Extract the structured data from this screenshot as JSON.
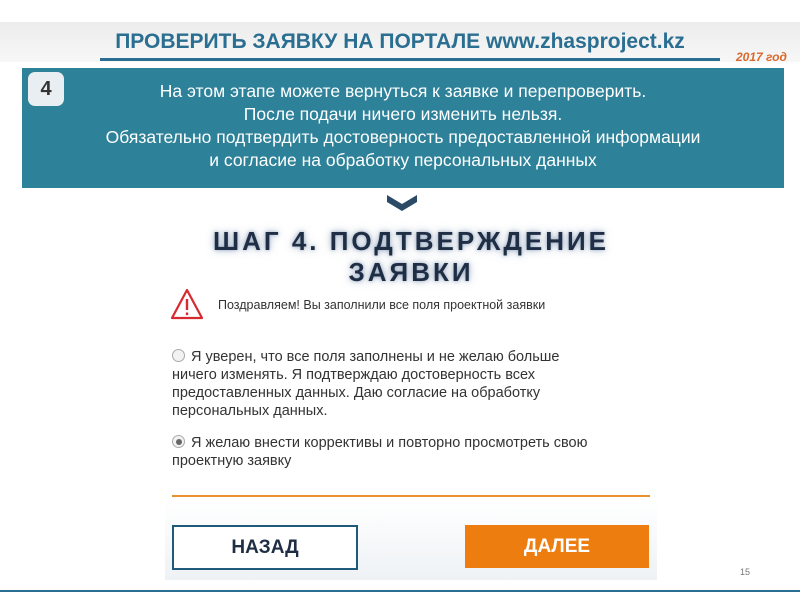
{
  "header": {
    "title": "ПРОВЕРИТЬ ЗАЯВКУ НА ПОРТАЛЕ www.zhasproject.kz",
    "year": "2017 год"
  },
  "banner": {
    "step_number": "4",
    "lines": [
      "На этом этапе можете вернуться к заявке и перепроверить.",
      "После подачи ничего изменить нельзя.",
      "Обязательно подтвердить достоверность предоставленной информации",
      "и согласие на обработку персональных данных"
    ]
  },
  "form": {
    "step_title": "ШАГ 4. ПОДТВЕРЖДЕНИЕ ЗАЯВКИ",
    "congrats": "Поздравляем! Вы заполнили все поля проектной заявки",
    "options": [
      {
        "lines": [
          "Я уверен, что все поля заполнены и не желаю больше",
          "ничего изменять. Я подтверждаю достоверность всех",
          "предоставленных данных. Даю согласие на обработку",
          "персональных данных."
        ],
        "checked": false
      },
      {
        "lines": [
          "Я желаю внести коррективы и повторно просмотреть свою",
          "проектную заявку"
        ],
        "checked": true
      }
    ],
    "back_label": "НАЗАД",
    "next_label": "ДАЛЕЕ"
  },
  "page_number": "15",
  "colors": {
    "brand": "#2a6f91",
    "banner": "#2d8199",
    "accent": "#ee7d10",
    "year": "#d9692c"
  },
  "icons": [
    "warning-icon",
    "chevron-down-icon"
  ]
}
